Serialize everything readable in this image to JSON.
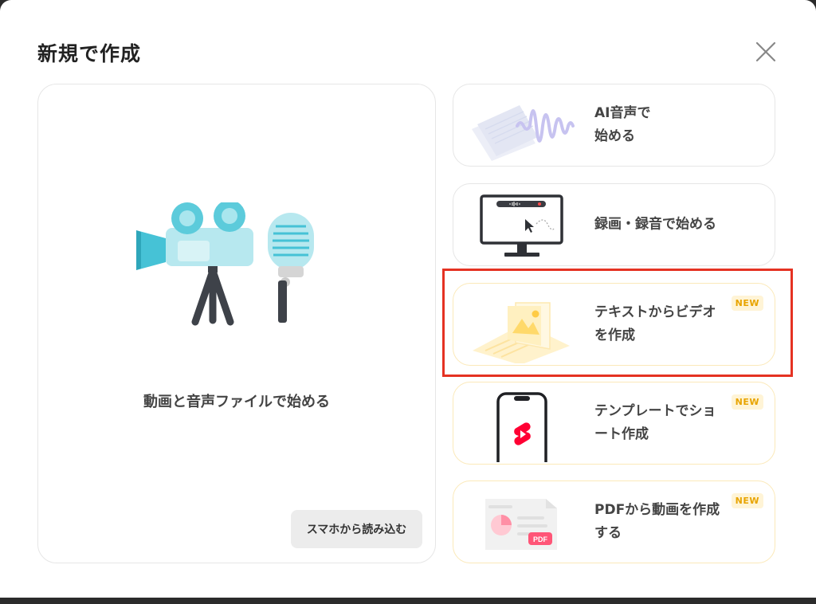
{
  "dialog": {
    "title": "新規で作成"
  },
  "main_card": {
    "label": "動画と音声ファイルで始める",
    "phone_button": "スマホから読み込む"
  },
  "options": [
    {
      "label": "AI音声で\n始める",
      "is_new": false
    },
    {
      "label": "録画・録音で始める",
      "is_new": false
    },
    {
      "label": "テキストからビデオ\nを作成",
      "is_new": true,
      "badge": "NEW",
      "highlighted": true
    },
    {
      "label": "テンプレートでショ\nート作成",
      "is_new": true,
      "badge": "NEW"
    },
    {
      "label": "PDFから動画を作成\nする",
      "is_new": true,
      "badge": "NEW",
      "pdf_tag": "PDF"
    }
  ],
  "colors": {
    "highlight": "#e53222",
    "new_badge_text": "#e8a400",
    "new_badge_bg": "#fff4d6",
    "camera_teal": "#5bc8d8",
    "record_red": "#ff0033"
  },
  "icons": [
    "close-icon",
    "camera-icon",
    "microphone-icon",
    "waveform-icon",
    "monitor-icon",
    "image-icon",
    "phone-icon",
    "shorts-icon",
    "pdf-icon"
  ]
}
